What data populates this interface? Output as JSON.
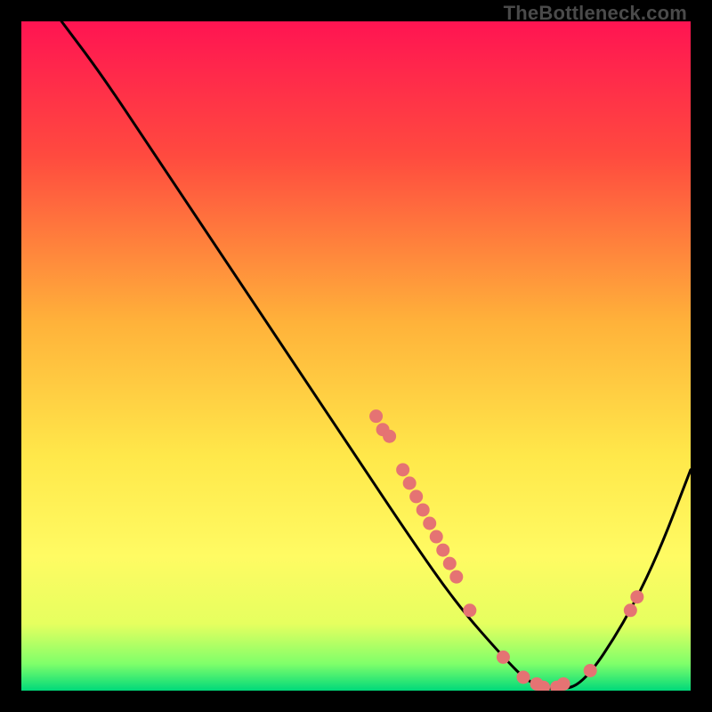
{
  "watermark": "TheBottleneck.com",
  "chart_data": {
    "type": "line",
    "xlim": [
      0,
      100
    ],
    "ylim": [
      0,
      100
    ],
    "curve": [
      {
        "x": 6,
        "y": 100
      },
      {
        "x": 12,
        "y": 92
      },
      {
        "x": 20,
        "y": 80
      },
      {
        "x": 30,
        "y": 65
      },
      {
        "x": 40,
        "y": 50
      },
      {
        "x": 50,
        "y": 35
      },
      {
        "x": 58,
        "y": 23
      },
      {
        "x": 65,
        "y": 13
      },
      {
        "x": 72,
        "y": 5
      },
      {
        "x": 76,
        "y": 1
      },
      {
        "x": 80,
        "y": 0
      },
      {
        "x": 84,
        "y": 1
      },
      {
        "x": 90,
        "y": 10
      },
      {
        "x": 95,
        "y": 20
      },
      {
        "x": 100,
        "y": 33
      }
    ],
    "markers": [
      {
        "x": 53,
        "y": 41
      },
      {
        "x": 54,
        "y": 39
      },
      {
        "x": 55,
        "y": 38
      },
      {
        "x": 57,
        "y": 33
      },
      {
        "x": 58,
        "y": 31
      },
      {
        "x": 59,
        "y": 29
      },
      {
        "x": 60,
        "y": 27
      },
      {
        "x": 61,
        "y": 25
      },
      {
        "x": 62,
        "y": 23
      },
      {
        "x": 63,
        "y": 21
      },
      {
        "x": 64,
        "y": 19
      },
      {
        "x": 65,
        "y": 17
      },
      {
        "x": 67,
        "y": 12
      },
      {
        "x": 72,
        "y": 5
      },
      {
        "x": 75,
        "y": 2
      },
      {
        "x": 77,
        "y": 1
      },
      {
        "x": 78,
        "y": 0.5
      },
      {
        "x": 80,
        "y": 0.5
      },
      {
        "x": 81,
        "y": 1
      },
      {
        "x": 85,
        "y": 3
      },
      {
        "x": 91,
        "y": 12
      },
      {
        "x": 92,
        "y": 14
      }
    ],
    "gradient_stops": [
      {
        "offset": 0.0,
        "color": "#ff1452"
      },
      {
        "offset": 0.2,
        "color": "#ff4a3f"
      },
      {
        "offset": 0.45,
        "color": "#ffb23a"
      },
      {
        "offset": 0.65,
        "color": "#ffe84a"
      },
      {
        "offset": 0.8,
        "color": "#fffb63"
      },
      {
        "offset": 0.9,
        "color": "#e6ff5f"
      },
      {
        "offset": 0.96,
        "color": "#7fff6a"
      },
      {
        "offset": 1.0,
        "color": "#00d97a"
      }
    ],
    "marker_color": "#e57373",
    "curve_color": "#000000"
  }
}
